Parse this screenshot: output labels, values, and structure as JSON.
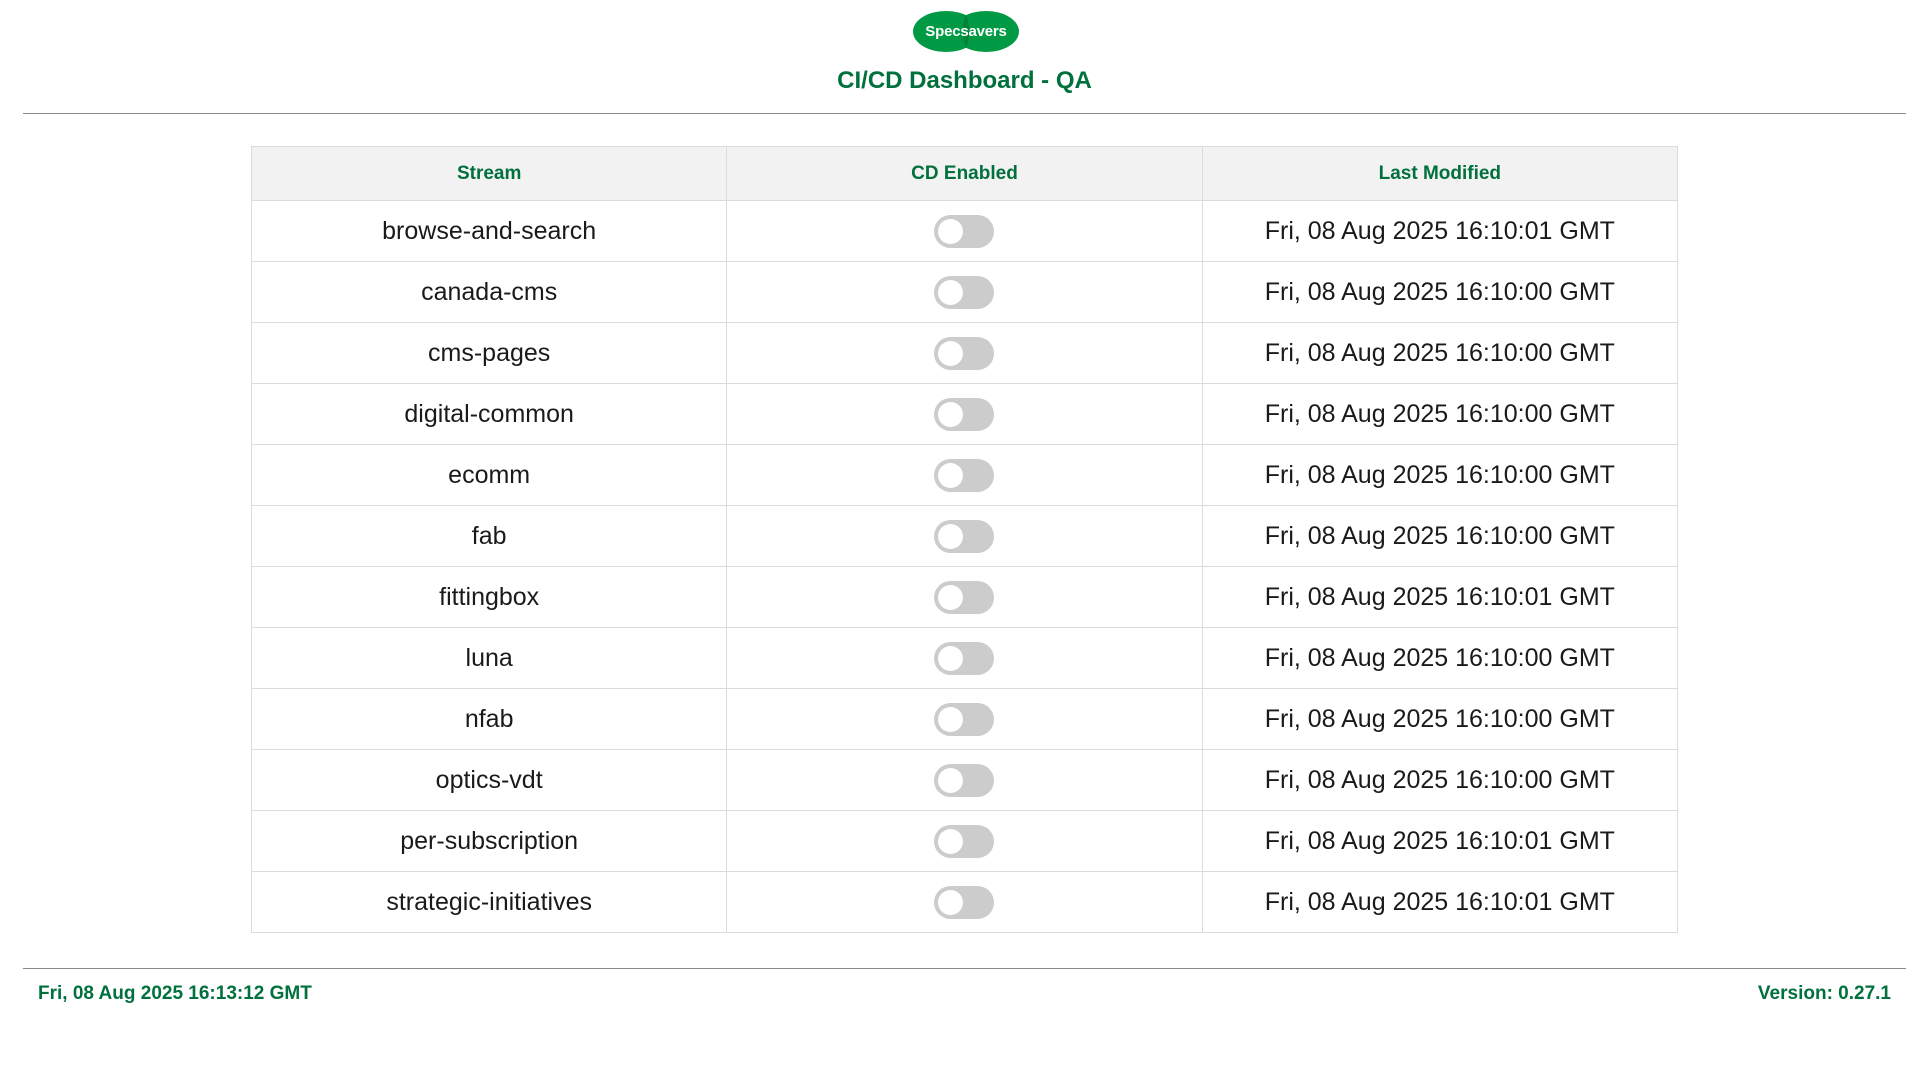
{
  "brand": {
    "logo_text": "Specsavers",
    "logo_color": "#009a44",
    "accent_color": "#00703c"
  },
  "header": {
    "title": "CI/CD Dashboard - QA"
  },
  "table": {
    "columns": [
      "Stream",
      "CD Enabled",
      "Last Modified"
    ],
    "rows": [
      {
        "stream": "browse-and-search",
        "cd_enabled": false,
        "last_modified": "Fri, 08 Aug 2025 16:10:01 GMT"
      },
      {
        "stream": "canada-cms",
        "cd_enabled": false,
        "last_modified": "Fri, 08 Aug 2025 16:10:00 GMT"
      },
      {
        "stream": "cms-pages",
        "cd_enabled": false,
        "last_modified": "Fri, 08 Aug 2025 16:10:00 GMT"
      },
      {
        "stream": "digital-common",
        "cd_enabled": false,
        "last_modified": "Fri, 08 Aug 2025 16:10:00 GMT"
      },
      {
        "stream": "ecomm",
        "cd_enabled": false,
        "last_modified": "Fri, 08 Aug 2025 16:10:00 GMT"
      },
      {
        "stream": "fab",
        "cd_enabled": false,
        "last_modified": "Fri, 08 Aug 2025 16:10:00 GMT"
      },
      {
        "stream": "fittingbox",
        "cd_enabled": false,
        "last_modified": "Fri, 08 Aug 2025 16:10:01 GMT"
      },
      {
        "stream": "luna",
        "cd_enabled": false,
        "last_modified": "Fri, 08 Aug 2025 16:10:00 GMT"
      },
      {
        "stream": "nfab",
        "cd_enabled": false,
        "last_modified": "Fri, 08 Aug 2025 16:10:00 GMT"
      },
      {
        "stream": "optics-vdt",
        "cd_enabled": false,
        "last_modified": "Fri, 08 Aug 2025 16:10:00 GMT"
      },
      {
        "stream": "per-subscription",
        "cd_enabled": false,
        "last_modified": "Fri, 08 Aug 2025 16:10:01 GMT"
      },
      {
        "stream": "strategic-initiatives",
        "cd_enabled": false,
        "last_modified": "Fri, 08 Aug 2025 16:10:01 GMT"
      }
    ]
  },
  "footer": {
    "timestamp": "Fri, 08 Aug 2025 16:13:12 GMT",
    "version": "Version: 0.27.1"
  }
}
